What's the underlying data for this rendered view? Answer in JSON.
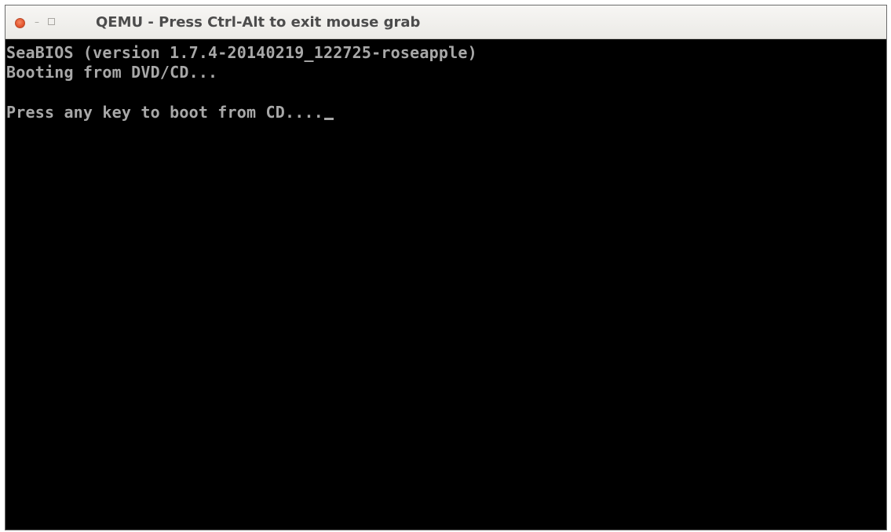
{
  "window": {
    "title": "QEMU - Press Ctrl-Alt to exit mouse grab",
    "buttons": {
      "close_icon": "close-icon",
      "minimize_glyph": "–",
      "maximize_icon": "maximize-icon"
    }
  },
  "console": {
    "lines": [
      "SeaBIOS (version 1.7.4-20140219_122725-roseapple)",
      "Booting from DVD/CD...",
      "Press any key to boot from CD...."
    ],
    "text_color": "#a8a8a8",
    "background": "#000000",
    "cursor": "_"
  },
  "colors": {
    "close_button": "#e4562f",
    "title_text": "#4c4c4c",
    "titlebar": "#f2f1ef"
  }
}
